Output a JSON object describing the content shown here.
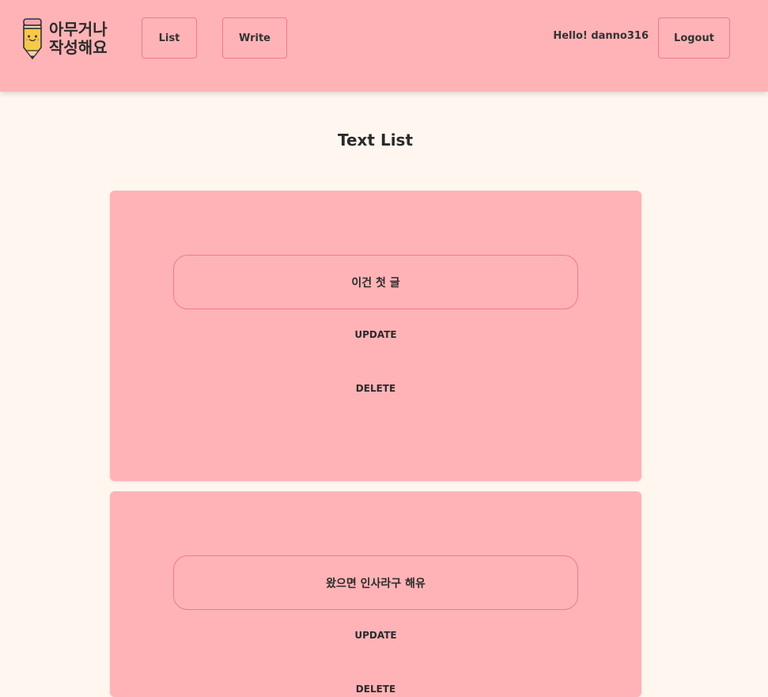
{
  "header": {
    "logo": {
      "line1": "아무거나",
      "line2": "작성해요",
      "icon": "pencil-mascot-icon"
    },
    "nav": {
      "list_label": "List",
      "write_label": "Write"
    },
    "greeting": "Hello! danno316",
    "logout_label": "Logout"
  },
  "page": {
    "title": "Text List"
  },
  "posts": [
    {
      "text": "이건 첫 글",
      "update_label": "UPDATE",
      "delete_label": "DELETE"
    },
    {
      "text": "왔으면 인사라구 해유",
      "update_label": "UPDATE",
      "delete_label": "DELETE"
    }
  ],
  "colors": {
    "header_bg": "#ffb3b6",
    "page_bg": "#fff7ef",
    "card_bg": "#ffb3b6",
    "border_accent": "#f07a8c",
    "pencil_body": "#f7c948"
  }
}
